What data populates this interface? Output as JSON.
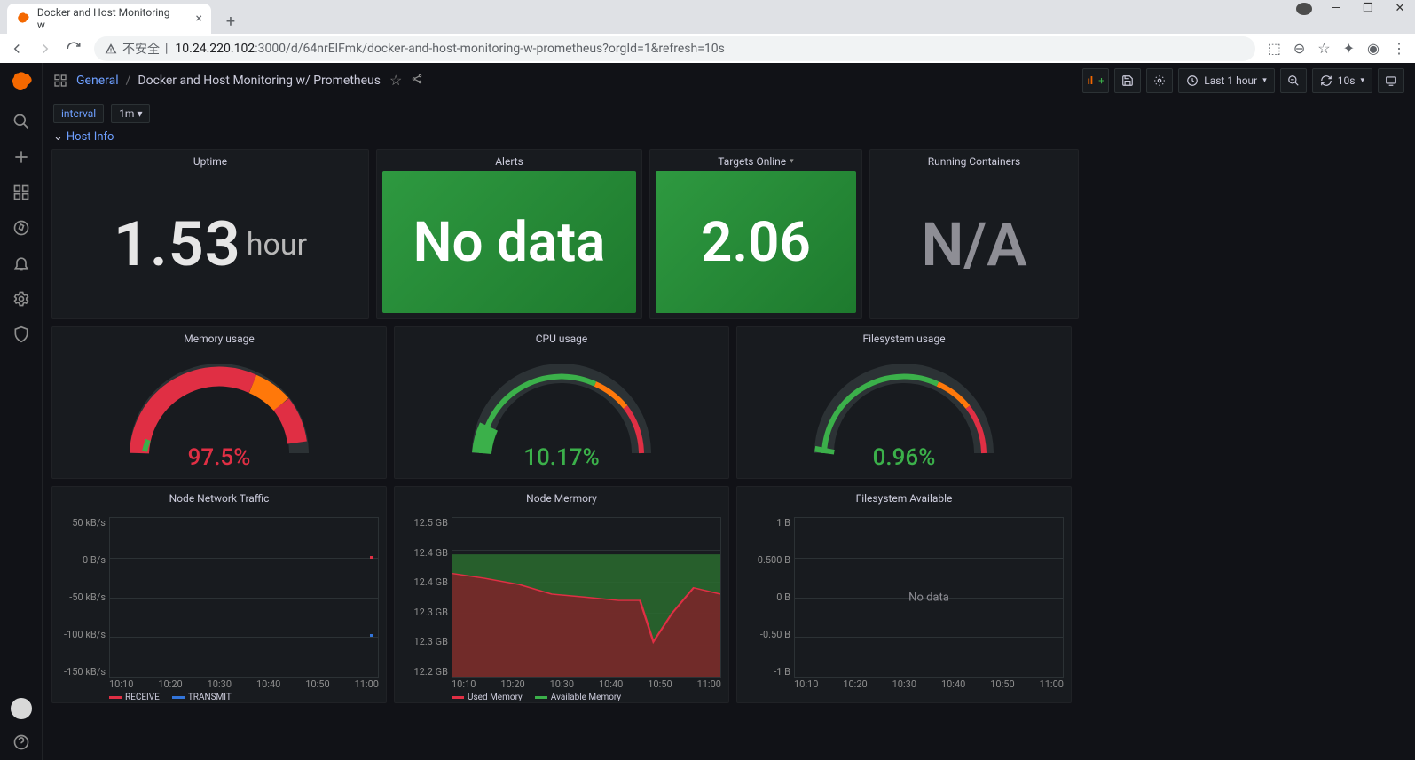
{
  "browser": {
    "tab_title": "Docker and Host Monitoring w",
    "url_insecure_label": "不安全",
    "url_origin": "10.24.220.102",
    "url_rest": ":3000/d/64nrElFmk/docker-and-host-monitoring-w-prometheus?orgId=1&refresh=10s"
  },
  "header": {
    "folder": "General",
    "title": "Docker and Host Monitoring w/ Prometheus",
    "time_label": "Last 1 hour",
    "refresh": "10s"
  },
  "variables": {
    "name": "interval",
    "value": "1m"
  },
  "row_title": "Host Info",
  "stats": {
    "uptime": {
      "title": "Uptime",
      "value": "1.53",
      "unit": "hour"
    },
    "alerts": {
      "title": "Alerts",
      "value": "No data"
    },
    "targets": {
      "title": "Targets Online",
      "value": "2.06"
    },
    "containers": {
      "title": "Running Containers",
      "value": "N/A"
    }
  },
  "gauges": {
    "memory": {
      "title": "Memory usage",
      "value": "97.5%",
      "pct": 97.5
    },
    "cpu": {
      "title": "CPU usage",
      "value": "10.17%",
      "pct": 10.17
    },
    "fs": {
      "title": "Filesystem usage",
      "value": "0.96%",
      "pct": 0.96
    }
  },
  "charts": {
    "network": {
      "title": "Node Network Traffic",
      "y_ticks": [
        "50 kB/s",
        "0 B/s",
        "-50 kB/s",
        "-100 kB/s",
        "-150 kB/s"
      ],
      "x_ticks": [
        "10:10",
        "10:20",
        "10:30",
        "10:40",
        "10:50",
        "11:00"
      ],
      "legend": [
        "RECEIVE",
        "TRANSMIT"
      ]
    },
    "memory": {
      "title": "Node Mermory",
      "y_ticks": [
        "12.5 GB",
        "12.4 GB",
        "12.4 GB",
        "12.3 GB",
        "12.3 GB",
        "12.2 GB"
      ],
      "x_ticks": [
        "10:10",
        "10:20",
        "10:30",
        "10:40",
        "10:50",
        "11:00"
      ],
      "legend": [
        "Used Memory",
        "Available Memory"
      ]
    },
    "filesystem": {
      "title": "Filesystem Available",
      "y_ticks": [
        "1 B",
        "0.500 B",
        "0 B",
        "-0.50 B",
        "-1 B"
      ],
      "x_ticks": [
        "10:10",
        "10:20",
        "10:30",
        "10:40",
        "10:50",
        "11:00"
      ],
      "nodata": "No data"
    }
  },
  "chart_data": [
    {
      "type": "line",
      "title": "Node Network Traffic",
      "x": [
        "10:10",
        "10:20",
        "10:30",
        "10:40",
        "10:50",
        "11:00"
      ],
      "series": [
        {
          "name": "RECEIVE",
          "values": [
            0,
            0,
            0,
            0,
            0,
            0
          ]
        },
        {
          "name": "TRANSMIT",
          "values": [
            0,
            0,
            0,
            0,
            0,
            0
          ]
        }
      ],
      "ylabel": "",
      "ylim": [
        -150,
        50
      ],
      "yunit": "kB/s"
    },
    {
      "type": "area",
      "title": "Node Mermory",
      "x": [
        "10:10",
        "10:20",
        "10:30",
        "10:40",
        "10:50",
        "11:00"
      ],
      "series": [
        {
          "name": "Used Memory",
          "values": [
            12.4,
            12.38,
            12.35,
            12.34,
            12.26,
            12.36
          ]
        },
        {
          "name": "Available Memory",
          "values": [
            12.43,
            12.43,
            12.43,
            12.43,
            12.43,
            12.43
          ]
        }
      ],
      "ylabel": "",
      "ylim": [
        12.2,
        12.5
      ],
      "yunit": "GB"
    },
    {
      "type": "line",
      "title": "Filesystem Available",
      "x": [
        "10:10",
        "10:20",
        "10:30",
        "10:40",
        "10:50",
        "11:00"
      ],
      "series": [],
      "ylabel": "",
      "ylim": [
        -1,
        1
      ],
      "yunit": "B"
    }
  ]
}
